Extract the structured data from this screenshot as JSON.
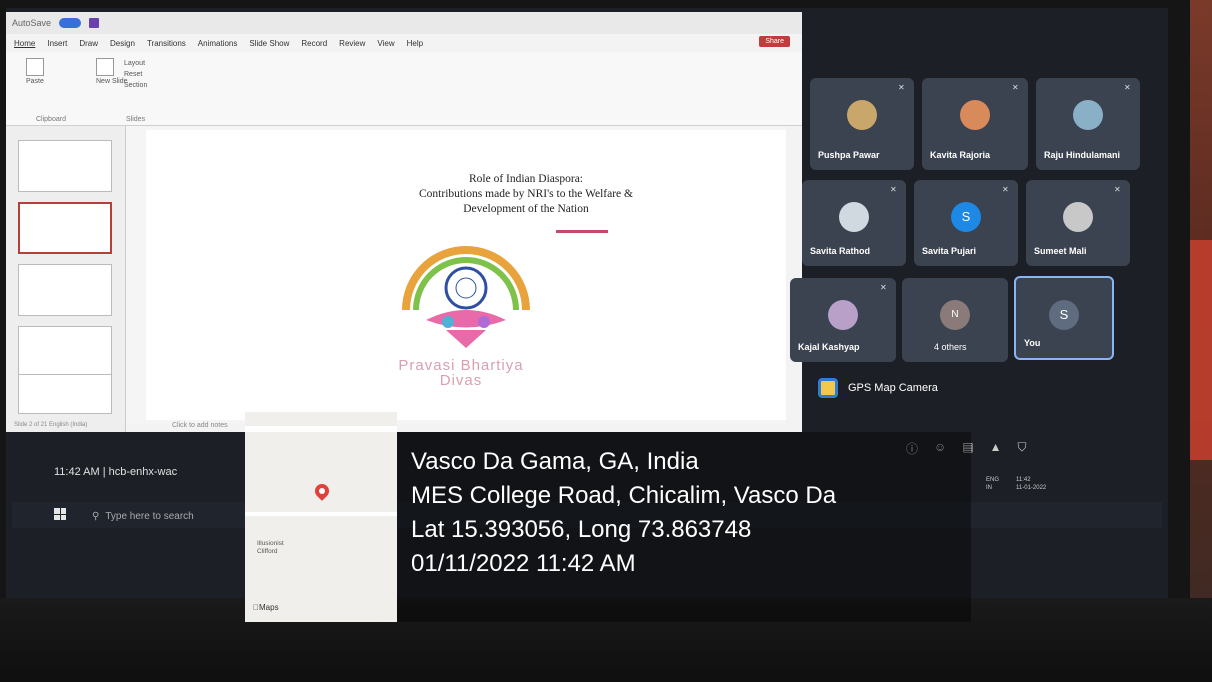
{
  "ppt": {
    "window_toggle_label": "AutoSave",
    "tabs": [
      "Home",
      "Insert",
      "Draw",
      "Design",
      "Transitions",
      "Animations",
      "Slide Show",
      "Record",
      "Review",
      "View",
      "Help"
    ],
    "share_label": "Share",
    "groups": {
      "clipboard": "Clipboard",
      "slides": "Slides",
      "paste": "Paste",
      "new_slide": "New Slide",
      "layout": "Layout",
      "reset": "Reset",
      "section": "Section"
    },
    "slide": {
      "title": "Role of Indian Diaspora:",
      "subtitle": "Contributions made by NRI's to the Welfare &",
      "subtitle2": "Development of the Nation",
      "logo_line1": "Pravasi Bhartiya",
      "logo_line2": "Divas"
    },
    "notes": "Click to add notes",
    "status": "Slide 2 of 21   English (India)"
  },
  "meet": {
    "participants": [
      {
        "name": "Pushpa Pawar",
        "avatar": "#c9a76a"
      },
      {
        "name": "Kavita Rajoria",
        "avatar": "#d88a5a"
      },
      {
        "name": "Raju Hindulamani",
        "avatar": "#8ab0c8"
      },
      {
        "name": "Savita Rathod",
        "avatar": "#d0d8e0"
      },
      {
        "name": "Savita Pujari",
        "avatar": "#1e88e5",
        "initial": "S"
      },
      {
        "name": "Sumeet Mali",
        "avatar": "#c8c8c8"
      },
      {
        "name": "Kajal Kashyap",
        "avatar": "#b8a0c8"
      },
      {
        "name": "4 others",
        "avatar": "#8a7a7a",
        "initial": "N"
      },
      {
        "name": "You",
        "avatar": "#5f6b7e",
        "initial": "S"
      }
    ],
    "meeting_code": "11:42 AM  |  hcb-enhx-wac",
    "gps_app": "GPS Map Camera"
  },
  "taskbar": {
    "search_placeholder": "Type here to search",
    "lang": "ENG",
    "region": "IN",
    "time": "11:42",
    "date": "11-01-2022"
  },
  "map": {
    "place": "Illusionist\nClifford",
    "brand": "Maps"
  },
  "gps": {
    "city": "Vasco Da Gama, GA, India",
    "address": "MES College Road, Chicalim, Vasco Da",
    "coords": "Lat 15.393056, Long 73.863748",
    "datetime": "01/11/2022 11:42 AM"
  },
  "colors": {
    "accent": "#8ab4f8",
    "share": "#c43b3b",
    "pin": "#e2403a"
  }
}
